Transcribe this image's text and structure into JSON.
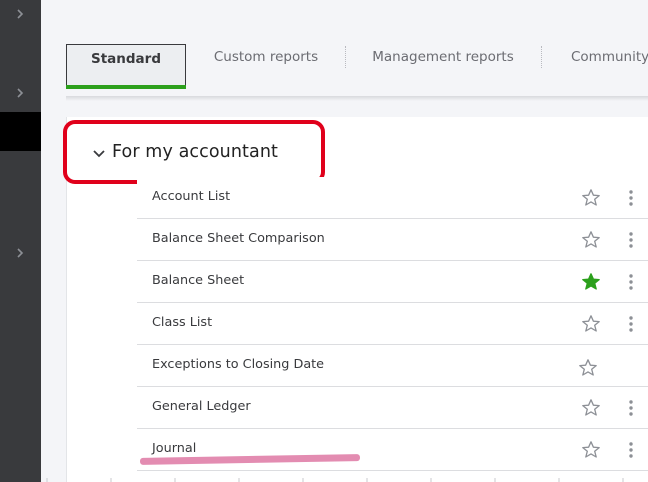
{
  "tabs": [
    {
      "label": "Standard",
      "active": true
    },
    {
      "label": "Custom reports",
      "active": false
    },
    {
      "label": "Management reports",
      "active": false
    },
    {
      "label": "Community",
      "active": false
    }
  ],
  "group": {
    "title": "For my accountant",
    "expanded": true,
    "highlight_color": "#e0001b"
  },
  "reports": [
    {
      "name": "Account List",
      "favorite": false,
      "has_menu": true
    },
    {
      "name": "Balance Sheet Comparison",
      "favorite": false,
      "has_menu": true
    },
    {
      "name": "Balance Sheet",
      "favorite": true,
      "has_menu": true
    },
    {
      "name": "Class List",
      "favorite": false,
      "has_menu": true
    },
    {
      "name": "Exceptions to Closing Date",
      "favorite": false,
      "has_menu": false
    },
    {
      "name": "General Ledger",
      "favorite": false,
      "has_menu": true
    },
    {
      "name": "Journal",
      "favorite": false,
      "has_menu": true
    }
  ],
  "colors": {
    "accent_green": "#2ca01c",
    "nav_dark": "#393a3d",
    "star_outline": "#8d9096",
    "annotation_pink": "#e080a8"
  }
}
